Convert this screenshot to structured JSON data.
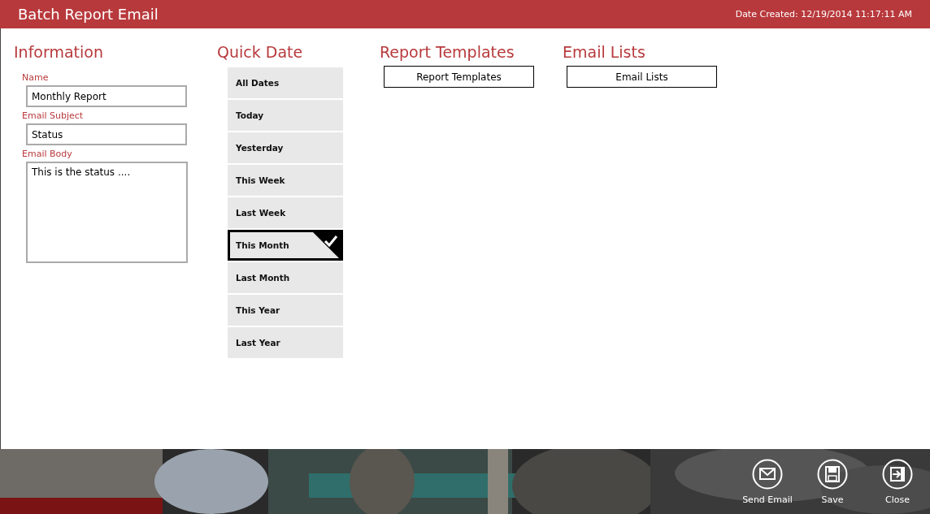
{
  "window": {
    "title": "Batch Report Email",
    "date_created": "Date Created: 12/19/2014 11:17:11 AM"
  },
  "information": {
    "heading": "Information",
    "fields": [
      {
        "label": "Name",
        "value": "Monthly Report",
        "kind": "line"
      },
      {
        "label": "Email Subject",
        "value": "Status",
        "kind": "line"
      },
      {
        "label": "Email Body",
        "value": "This is the status ....",
        "kind": "area"
      }
    ]
  },
  "quick_date": {
    "heading": "Quick Date",
    "items": [
      {
        "label": "All Dates",
        "selected": false
      },
      {
        "label": "Today",
        "selected": false
      },
      {
        "label": "Yesterday",
        "selected": false
      },
      {
        "label": "This Week",
        "selected": false
      },
      {
        "label": "Last Week",
        "selected": false
      },
      {
        "label": "This Month",
        "selected": true
      },
      {
        "label": "Last Month",
        "selected": false
      },
      {
        "label": "This Year",
        "selected": false
      },
      {
        "label": "Last Year",
        "selected": false
      }
    ]
  },
  "report_templates": {
    "heading": "Report Templates",
    "button": "Report Templates"
  },
  "email_lists": {
    "heading": "Email Lists",
    "button": "Email Lists"
  },
  "footer": {
    "actions": [
      {
        "label": "Send Email",
        "kind": "mail"
      },
      {
        "label": "Save",
        "kind": "save"
      },
      {
        "label": "Close",
        "kind": "exit"
      }
    ]
  }
}
